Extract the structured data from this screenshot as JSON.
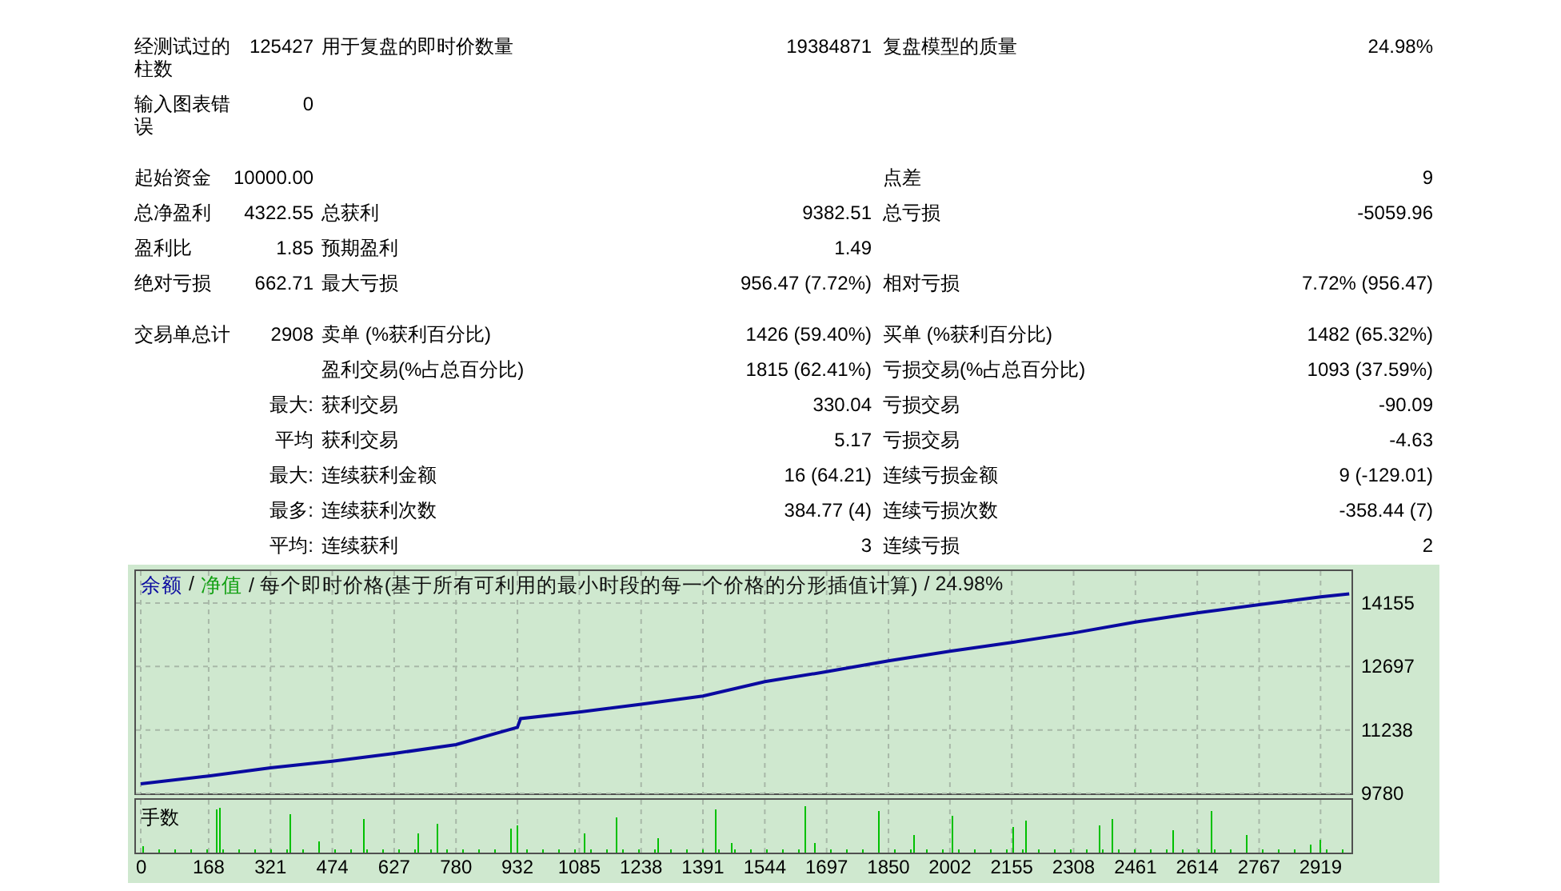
{
  "stats": {
    "sections": [
      {
        "rows": [
          {
            "label_1": "经测试过的柱数",
            "value_1": "125427",
            "label_2": "用于复盘的即时价数量",
            "value_2": "19384871",
            "label_3": "复盘模型的质量",
            "value_3": "24.98%"
          },
          {
            "label_1": "输入图表错误",
            "value_1": "0"
          }
        ]
      },
      {
        "rows": [
          {
            "label_1": "起始资金",
            "value_1": "10000.00",
            "label_3": "点差",
            "value_3": "9"
          },
          {
            "label_1": "总净盈利",
            "value_1": "4322.55",
            "label_2": "总获利",
            "value_2": "9382.51",
            "label_3": "总亏损",
            "value_3": "-5059.96"
          },
          {
            "label_1": "盈利比",
            "value_1": "1.85",
            "label_2": "预期盈利",
            "value_2": "1.49"
          },
          {
            "label_1": "绝对亏损",
            "value_1": "662.71",
            "label_2": "最大亏损",
            "value_2": "956.47 (7.72%)",
            "label_3": "相对亏损",
            "value_3": "7.72% (956.47)"
          }
        ]
      },
      {
        "rows": [
          {
            "label_1": "交易单总计",
            "value_1": "2908",
            "label_2": "卖单 (%获利百分比)",
            "value_2": "1426 (59.40%)",
            "label_3": "买单 (%获利百分比)",
            "value_3": "1482 (65.32%)"
          },
          {
            "label_2": "盈利交易(%占总百分比)",
            "value_2": "1815 (62.41%)",
            "label_3": "亏损交易(%占总百分比)",
            "value_3": "1093 (37.59%)"
          },
          {
            "value_1": "最大:",
            "label_2": "获利交易",
            "value_2": "330.04",
            "label_3": "亏损交易",
            "value_3": "-90.09"
          },
          {
            "value_1": "平均",
            "label_2": "获利交易",
            "value_2": "5.17",
            "label_3": "亏损交易",
            "value_3": "-4.63"
          },
          {
            "value_1": "最大:",
            "label_2": "连续获利金额",
            "value_2": "16 (64.21)",
            "label_3": "连续亏损金额",
            "value_3": "9 (-129.01)"
          },
          {
            "value_1": "最多:",
            "label_2": "连续获利次数",
            "value_2": "384.77 (4)",
            "label_3": "连续亏损次数",
            "value_3": "-358.44 (7)"
          },
          {
            "value_1": "平均:",
            "label_2": "连续获利",
            "value_2": "3",
            "label_3": "连续亏损",
            "value_3": "2"
          }
        ]
      }
    ]
  },
  "graph": {
    "title_parts": [
      {
        "text": "/"
      },
      {
        "text": "净值",
        "color": "#12a012"
      },
      {
        "text": "/ 每个即时价格(基于所有可利用的最小时段的每一个价格的分形插值计算)"
      },
      {
        "text": "/ 24.98%"
      }
    ],
    "volume_label": "手数",
    "chart_data": {
      "type": "line",
      "x": [
        0,
        168,
        321,
        474,
        627,
        780,
        932,
        940,
        1085,
        1238,
        1391,
        1544,
        1697,
        1850,
        2002,
        2155,
        2308,
        2461,
        2614,
        2767,
        2919,
        2990
      ],
      "series": [
        {
          "name": "余额",
          "color": "#0a0aa0",
          "values": [
            10000,
            10180,
            10370,
            10520,
            10700,
            10900,
            11300,
            11500,
            11650,
            11830,
            12020,
            12350,
            12580,
            12830,
            13050,
            13250,
            13470,
            13720,
            13930,
            14120,
            14300,
            14370
          ]
        }
      ],
      "grid": true,
      "xlim": [
        0,
        2994
      ],
      "ylim": [
        9780,
        14928
      ],
      "xticks": [
        0,
        168,
        321,
        474,
        627,
        780,
        932,
        1085,
        1238,
        1391,
        1544,
        1697,
        1850,
        2002,
        2155,
        2308,
        2461,
        2614,
        2767,
        2919
      ],
      "yticks": [
        9780,
        11238,
        12697,
        14155
      ]
    }
  }
}
